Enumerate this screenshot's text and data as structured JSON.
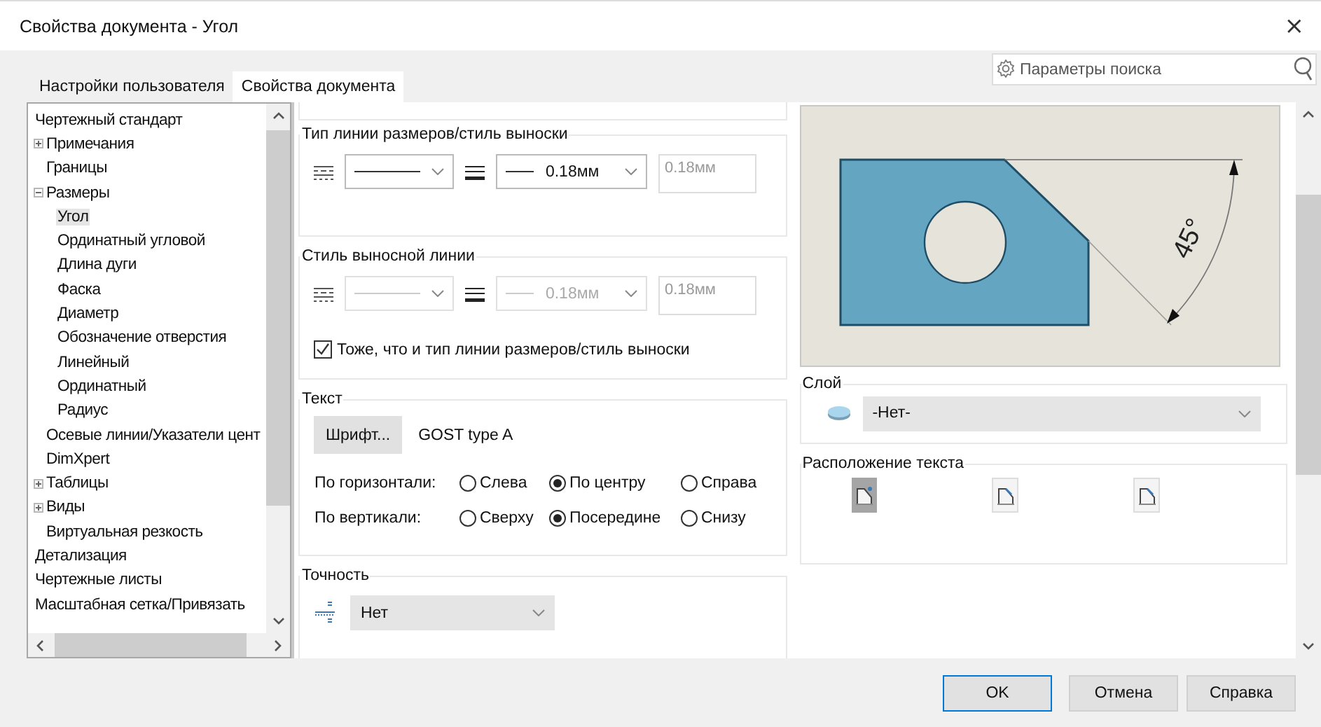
{
  "window": {
    "title": "Свойства документа - Угол",
    "close": "×"
  },
  "tabs": [
    {
      "label": "Настройки пользователя",
      "selected": false
    },
    {
      "label": "Свойства документа",
      "selected": true
    }
  ],
  "search": {
    "placeholder": "Параметры поиска"
  },
  "tree": {
    "items": [
      {
        "label": "Чертежный стандарт",
        "selected": false,
        "children": [
          {
            "label": "Примечания",
            "selected": false,
            "expanded": false
          },
          {
            "label": "Границы",
            "selected": false
          },
          {
            "label": "Размеры",
            "selected": false,
            "expanded": true,
            "children": [
              {
                "label": "Угол",
                "selected": true
              },
              {
                "label": "Ординатный угловой",
                "selected": false
              },
              {
                "label": "Длина дуги",
                "selected": false
              },
              {
                "label": "Фаска",
                "selected": false
              },
              {
                "label": "Диаметр",
                "selected": false
              },
              {
                "label": "Обозначение отверстия",
                "selected": false
              },
              {
                "label": "Линейный",
                "selected": false
              },
              {
                "label": "Ординатный",
                "selected": false
              },
              {
                "label": "Радиус",
                "selected": false
              }
            ]
          },
          {
            "label": "Осевые линии/Указатели цент",
            "selected": false
          },
          {
            "label": "DimXpert",
            "selected": false
          },
          {
            "label": "Таблицы",
            "selected": false,
            "expanded": false
          },
          {
            "label": "Виды",
            "selected": false,
            "expanded": false
          },
          {
            "label": "Виртуальная резкость",
            "selected": false
          }
        ]
      },
      {
        "label": "Детализация",
        "selected": false
      },
      {
        "label": "Чертежные листы",
        "selected": false
      },
      {
        "label": "Масштабная сетка/Привязать",
        "selected": false
      }
    ]
  },
  "groups": [
    {
      "kind": "lines",
      "title": "Тип линии размеров/стиль выноски",
      "disabled": false,
      "thickness": "0.18мм",
      "custom_thickness": "0.18мм"
    },
    {
      "kind": "lines",
      "title": "Стиль выносной линии",
      "disabled": true,
      "thickness": "0.18мм",
      "custom_thickness": "0.18мм",
      "checkbox": {
        "label": "Тоже, что и тип линии размеров/стиль выноски",
        "checked": true
      }
    },
    {
      "kind": "text",
      "title": "Текст",
      "font_button": "Шрифт...",
      "font_name": "GOST type A",
      "alignments": [
        {
          "label": "По горизонтали:",
          "options": [
            {
              "label": "Слева",
              "selected": false
            },
            {
              "label": "По центру",
              "selected": true
            },
            {
              "label": "Справа",
              "selected": false
            }
          ]
        },
        {
          "label": "По вертикали:",
          "options": [
            {
              "label": "Сверху",
              "selected": false
            },
            {
              "label": "Посередине",
              "selected": true
            },
            {
              "label": "Снизу",
              "selected": false
            }
          ]
        }
      ]
    },
    {
      "kind": "precision",
      "title": "Точность",
      "value": "Нет"
    }
  ],
  "preview": {
    "angle_label": "45°"
  },
  "layer": {
    "title": "Слой",
    "value": "-Нет-"
  },
  "text_position": {
    "title": "Расположение текста",
    "options": [
      {
        "selected": true
      },
      {
        "selected": false
      },
      {
        "selected": false
      }
    ]
  },
  "buttons": [
    {
      "label": "OK",
      "default": true
    },
    {
      "label": "Отмена",
      "default": false
    },
    {
      "label": "Справка",
      "default": false
    }
  ]
}
